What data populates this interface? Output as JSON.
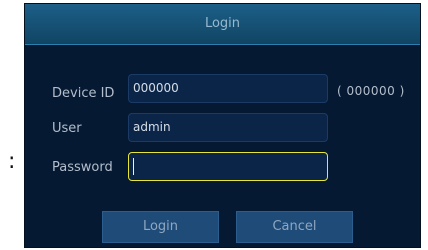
{
  "outside": {
    "colon": ":"
  },
  "dialog": {
    "title": "Login",
    "device_id": {
      "label": "Device ID",
      "value": "000000",
      "hint": "( 000000 )"
    },
    "user": {
      "label": "User",
      "value": "admin"
    },
    "password": {
      "label": "Password",
      "value": ""
    },
    "buttons": {
      "login": "Login",
      "cancel": "Cancel"
    }
  },
  "colors": {
    "dialog_bg": "#051932",
    "titlebar": "#1c5f88",
    "field_bg": "#0b2548",
    "focus_border": "#e8e53a",
    "button_bg": "#1f4b78"
  }
}
